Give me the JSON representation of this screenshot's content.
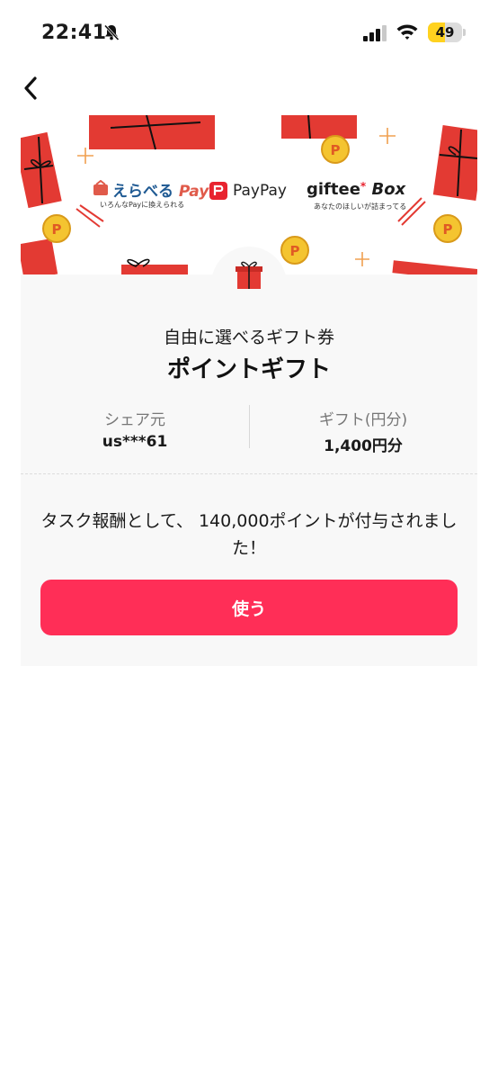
{
  "status_bar": {
    "time": "22:41",
    "battery": "49",
    "battery_level": 0.49,
    "icons": [
      "bell-slash-icon",
      "signal-icon",
      "wifi-icon",
      "battery-icon"
    ]
  },
  "nav": {
    "back_icon": "chevron-left-icon"
  },
  "banner": {
    "logos": {
      "erabe_main": "えらべる",
      "erabe_pay": "Pay",
      "erabe_sub": "いろんなPayに換えられる",
      "paypay": "PayPay",
      "giftee_main": "giftee",
      "giftee_box": "Box",
      "giftee_star": "*",
      "giftee_sub": "あなたのほしいが詰まってる"
    },
    "gift_icon": "gift-box-icon"
  },
  "gift": {
    "subtitle": "自由に選べるギフト券",
    "title": "ポイントギフト",
    "sender_label": "シェア元",
    "sender_value": "us***61",
    "amount_label": "ギフト(円分)",
    "amount_value": "1,400円分"
  },
  "message": "タスク報酬として、 140,000ポイントが付与されました！",
  "use_button": "使う",
  "colors": {
    "accent": "#ff2e57",
    "gift_red": "#e33a33",
    "coin_yellow": "#f4c430",
    "battery_yellow": "#ffd21f",
    "card_bg": "#f8f8f8"
  }
}
